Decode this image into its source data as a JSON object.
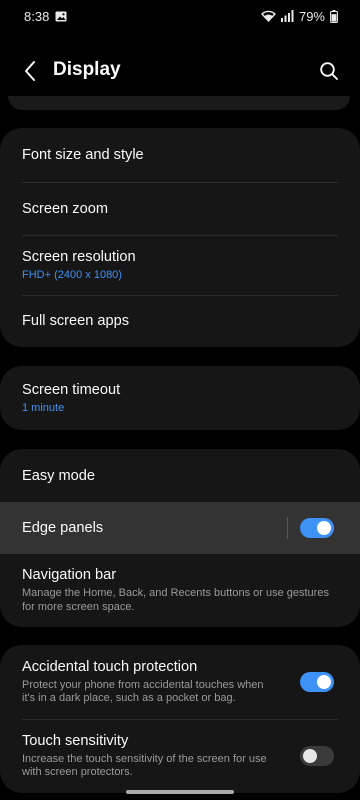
{
  "status_bar": {
    "time": "8:38",
    "battery": "79%",
    "icons": [
      "image-icon",
      "wifi-icon",
      "signal-icon",
      "battery-icon"
    ]
  },
  "header": {
    "title": "Display"
  },
  "groups": [
    {
      "items": [
        {
          "title": "Font size and style"
        },
        {
          "title": "Screen zoom"
        },
        {
          "title": "Screen resolution",
          "subtitle": "FHD+ (2400 x 1080)"
        },
        {
          "title": "Full screen apps"
        }
      ]
    },
    {
      "items": [
        {
          "title": "Screen timeout",
          "subtitle": "1 minute"
        }
      ]
    },
    {
      "items": [
        {
          "title": "Easy mode"
        },
        {
          "title": "Edge panels",
          "toggle": true
        },
        {
          "title": "Navigation bar",
          "description": "Manage the Home, Back, and Recents buttons or use gestures for more screen space."
        }
      ]
    },
    {
      "items": [
        {
          "title": "Accidental touch protection",
          "description": "Protect your phone from accidental touches when it's in a dark place, such as a pocket or bag.",
          "toggle": true
        },
        {
          "title": "Touch sensitivity",
          "description": "Increase the touch sensitivity of the screen for use with screen protectors.",
          "toggle": false
        }
      ]
    }
  ],
  "colors": {
    "accent": "#3e91f5",
    "card_background": "#161616",
    "highlight_background": "#333333",
    "page_background": "#000000"
  }
}
